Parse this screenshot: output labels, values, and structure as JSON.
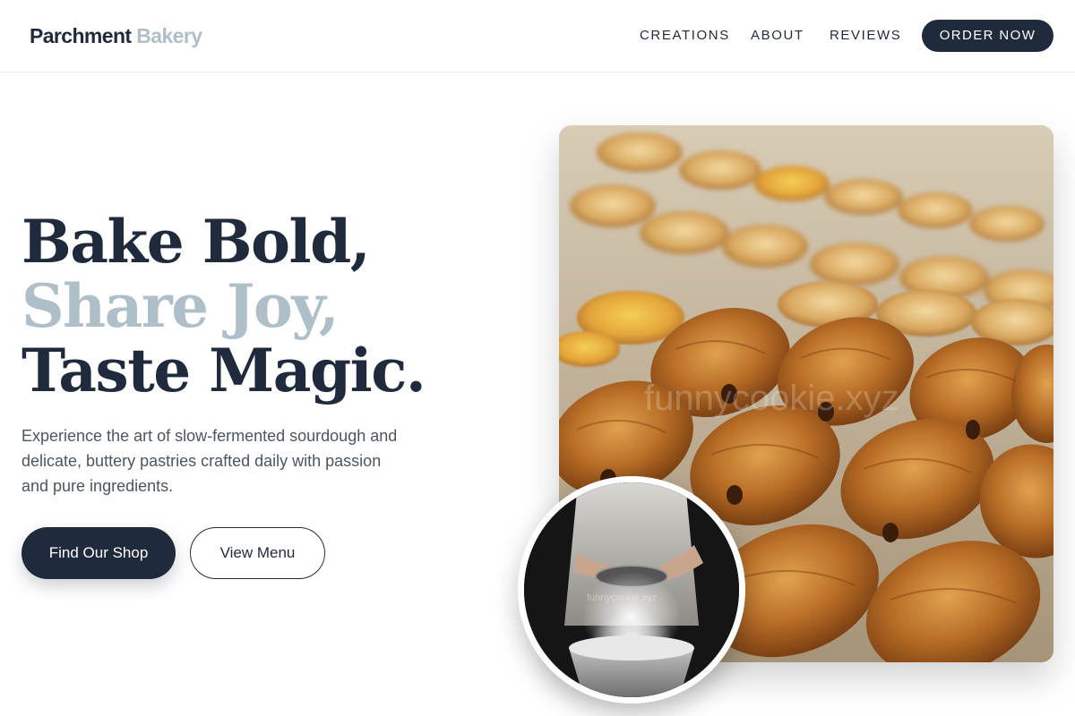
{
  "header": {
    "logo_primary": "Parchment",
    "logo_accent": "Bakery",
    "nav": [
      {
        "label": "CREATIONS"
      },
      {
        "label": "ABOUT"
      },
      {
        "label": "REVIEWS"
      }
    ],
    "cta_label": "ORDER NOW"
  },
  "hero": {
    "line1": "Bake Bold,",
    "line2": "Share Joy,",
    "line3": "Taste Magic.",
    "description": "Experience the art of slow-fermented sourdough and delicate, buttery pastries crafted daily with passion and pure ingredients.",
    "primary_button": "Find Our Shop",
    "secondary_button": "View Menu"
  },
  "images": {
    "main_watermark": "funnycookie.xyz",
    "circle_watermark": "funnycookie.xyz"
  },
  "colors": {
    "brand_dark": "#1f2a3c",
    "brand_light": "#aebfca",
    "text_muted": "#4b5563"
  }
}
